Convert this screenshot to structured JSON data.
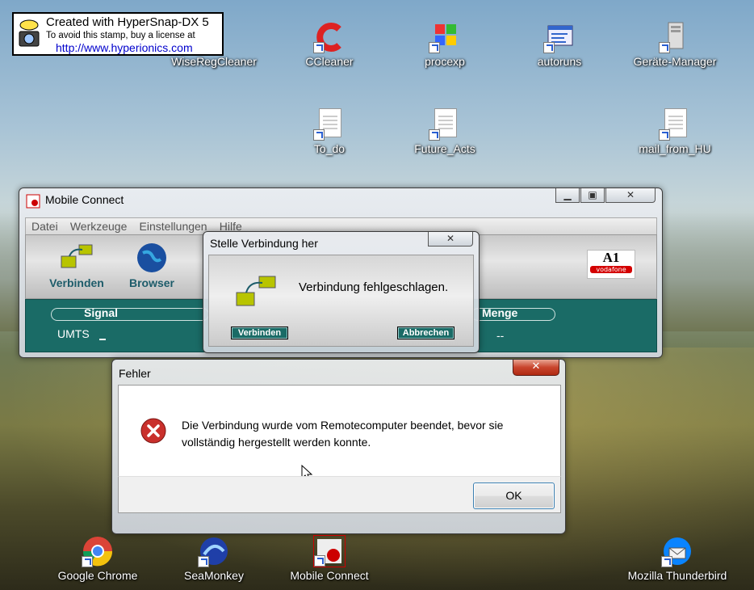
{
  "stamp": {
    "line1": "Created with HyperSnap-DX 5",
    "line2": "To avoid this stamp, buy a license at",
    "line3": "http://www.hyperionics.com"
  },
  "desktop": {
    "top_icons": [
      {
        "label": "WiseRegCleaner",
        "icon": "wiseregcleaner-icon"
      },
      {
        "label": "CCleaner",
        "icon": "ccleaner-icon"
      },
      {
        "label": "procexp",
        "icon": "procexp-icon"
      },
      {
        "label": "autoruns",
        "icon": "autoruns-icon"
      },
      {
        "label": "Geräte-Manager",
        "icon": "device-manager-icon"
      }
    ],
    "doc_icons": [
      {
        "label": "To_do",
        "icon": "document-icon"
      },
      {
        "label": "Future_Acts",
        "icon": "document-icon"
      },
      {
        "label": "mail_from_HU",
        "icon": "document-icon"
      }
    ],
    "bottom_icons": [
      {
        "label": "Google Chrome",
        "icon": "chrome-icon"
      },
      {
        "label": "SeaMonkey",
        "icon": "seamonkey-icon"
      },
      {
        "label": "Mobile Connect",
        "icon": "mobile-connect-icon"
      },
      {
        "label": "Mozilla Thunderbird",
        "icon": "thunderbird-icon"
      }
    ]
  },
  "mobile_connect": {
    "title": "Mobile Connect",
    "menu": [
      "Datei",
      "Werkzeuge",
      "Einstellungen",
      "Hilfe"
    ],
    "toolbar": {
      "connect": "Verbinden",
      "browser": "Browser"
    },
    "band": {
      "signal": "Signal",
      "network": "UMTS",
      "menge": "Menge",
      "menge_value": "--"
    },
    "brand": {
      "logo": "A1",
      "sub": "vodafone"
    }
  },
  "connect_dialog": {
    "title": "Stelle Verbindung her",
    "message": "Verbindung fehlgeschlagen.",
    "connect_button": "Verbinden",
    "cancel_button": "Abbrechen"
  },
  "error_dialog": {
    "title": "Fehler",
    "message_line1": "Die Verbindung wurde vom Remotecomputer beendet, bevor sie",
    "message_line2": "vollständig hergestellt werden konnte.",
    "ok_button": "OK"
  },
  "colors": {
    "accent_teal": "#1a6b66",
    "error_red": "#c9302c",
    "brand_red": "#d40000"
  }
}
